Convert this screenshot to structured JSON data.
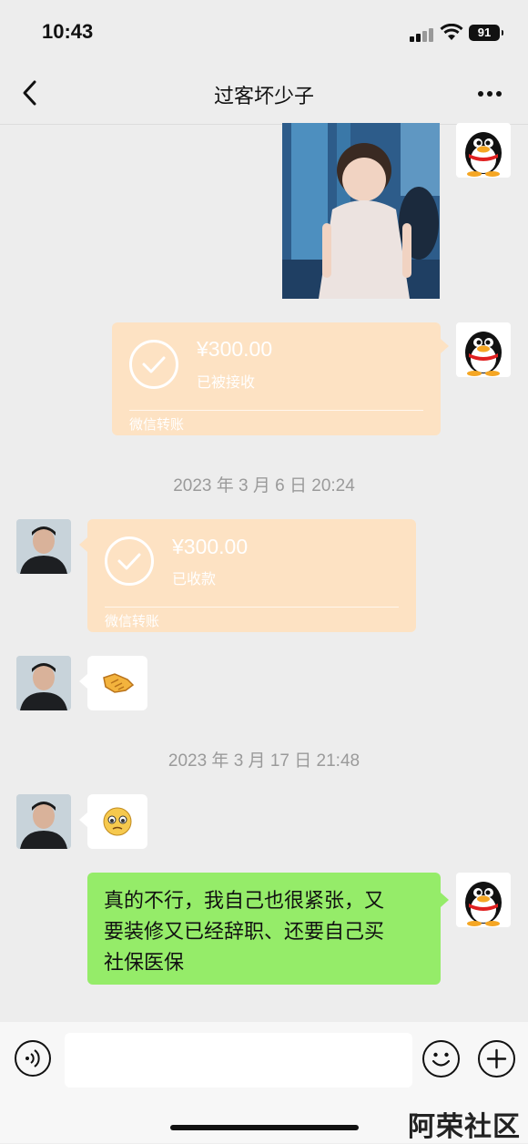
{
  "status_bar": {
    "time": "10:43",
    "battery": "91"
  },
  "header": {
    "title": "过客坏少子"
  },
  "messages": {
    "transfer_sent": {
      "amount": "¥300.00",
      "status": "已被接收",
      "footer": "微信转账"
    },
    "timestamp_1": "2023 年 3 月 6 日 20:24",
    "transfer_received": {
      "amount": "¥300.00",
      "status": "已收款",
      "footer": "微信转账"
    },
    "timestamp_2": "2023 年 3 月 17 日 21:48",
    "text_sent": {
      "lines": [
        "真的不行，我自己也很紧张，又",
        "要装修又已经辞职、还要自己买",
        "社保医保"
      ]
    }
  },
  "icons": {
    "avatar_self": "qq-penguin-avatar",
    "avatar_other": "user-photo-avatar",
    "emoji_1": "handshake-emoji",
    "emoji_2": "pleading-face-emoji"
  },
  "colors": {
    "transfer_bg": "#fde2c3",
    "sent_bubble": "#95ec69",
    "background": "#ededed"
  },
  "watermark": "阿荣社区"
}
